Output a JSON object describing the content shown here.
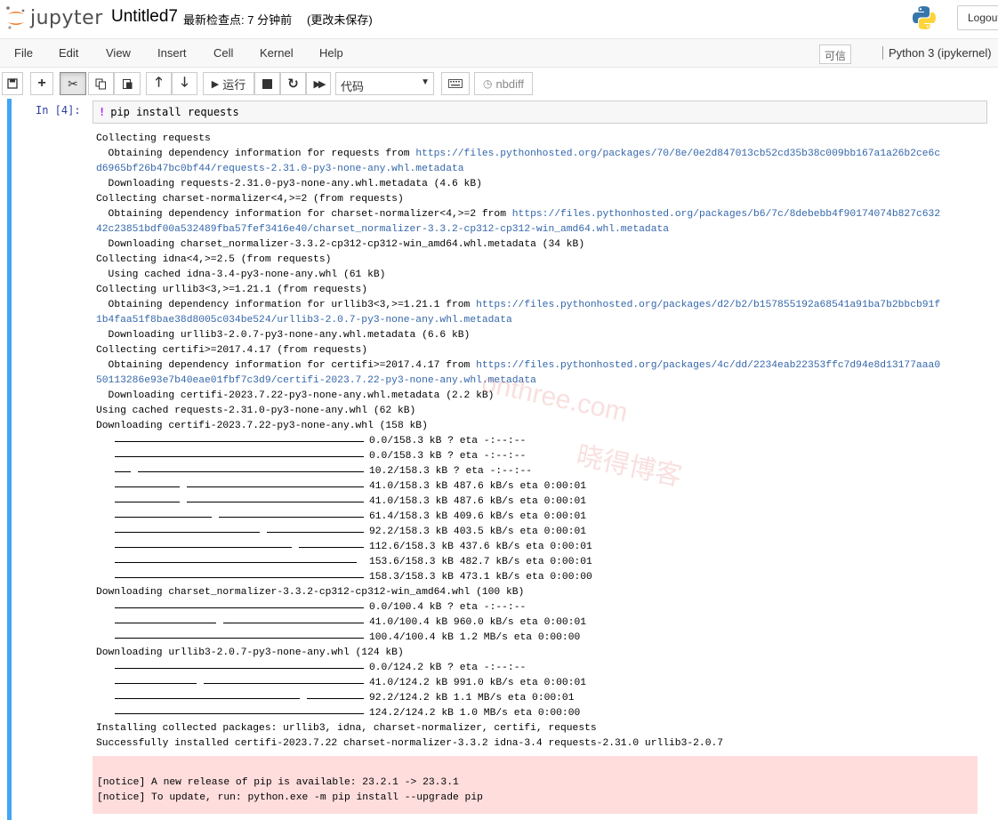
{
  "header": {
    "logo_text": "jupyter",
    "notebook_name": "Untitled7",
    "checkpoint": "最新检查点: 7 分钟前",
    "autosave": "(更改未保存)",
    "logout_label": "Logout"
  },
  "menubar": {
    "items": [
      "File",
      "Edit",
      "View",
      "Insert",
      "Cell",
      "Kernel",
      "Help"
    ],
    "trusted": "可信",
    "kernel": "Python 3 (ipykernel)"
  },
  "toolbar": {
    "run_label": "运行",
    "cell_type": "代码",
    "nbdiff_label": "nbdiff"
  },
  "cell": {
    "prompt": "In  [4]:",
    "code": "pip install requests",
    "output_lines": [
      {
        "text": "Collecting requests"
      },
      {
        "text": "  Obtaining dependency information for requests from ",
        "link": "https://files.pythonhosted.org/packages/70/8e/0e2d847013cb52cd35b38c009bb167a1a26b2ce6c"
      },
      {
        "text": "",
        "link": "d6965bf26b47bc0bf44/requests-2.31.0-py3-none-any.whl.metadata"
      },
      {
        "text": "  Downloading requests-2.31.0-py3-none-any.whl.metadata (4.6 kB)"
      },
      {
        "text": "Collecting charset-normalizer<4,>=2 (from requests)"
      },
      {
        "text": "  Obtaining dependency information for charset-normalizer<4,>=2 from ",
        "link": "https://files.pythonhosted.org/packages/b6/7c/8debebb4f90174074b827c632"
      },
      {
        "text": "",
        "link": "42c23851bdf00a532489fba57fef3416e40/charset_normalizer-3.3.2-cp312-cp312-win_amd64.whl.metadata"
      },
      {
        "text": "  Downloading charset_normalizer-3.3.2-cp312-cp312-win_amd64.whl.metadata (34 kB)"
      },
      {
        "text": "Collecting idna<4,>=2.5 (from requests)"
      },
      {
        "text": "  Using cached idna-3.4-py3-none-any.whl (61 kB)"
      },
      {
        "text": "Collecting urllib3<3,>=1.21.1 (from requests)"
      },
      {
        "text": "  Obtaining dependency information for urllib3<3,>=1.21.1 from ",
        "link": "https://files.pythonhosted.org/packages/d2/b2/b157855192a68541a91ba7b2bbcb91f"
      },
      {
        "text": "",
        "link": "1b4faa51f8bae38d8005c034be524/urllib3-2.0.7-py3-none-any.whl.metadata"
      },
      {
        "text": "  Downloading urllib3-2.0.7-py3-none-any.whl.metadata (6.6 kB)"
      },
      {
        "text": "Collecting certifi>=2017.4.17 (from requests)"
      },
      {
        "text": "  Obtaining dependency information for certifi>=2017.4.17 from ",
        "link": "https://files.pythonhosted.org/packages/4c/dd/2234eab22353ffc7d94e8d13177aaa0"
      },
      {
        "text": "",
        "link": "50113286e93e7b40eae01fbf7c3d9/certifi-2023.7.22-py3-none-any.whl.metadata"
      },
      {
        "text": "  Downloading certifi-2023.7.22-py3-none-any.whl.metadata (2.2 kB)"
      },
      {
        "text": "Using cached requests-2.31.0-py3-none-any.whl (62 kB)"
      },
      {
        "text": "Downloading certifi-2023.7.22-py3-none-any.whl (158 kB)"
      },
      {
        "progress": 0.0,
        "text": "0.0/158.3 kB ? eta -:--:--"
      },
      {
        "progress": 0.0,
        "text": "0.0/158.3 kB ? eta -:--:--"
      },
      {
        "progress": 0.064,
        "text": "10.2/158.3 kB ? eta -:--:--"
      },
      {
        "progress": 0.259,
        "text": "41.0/158.3 kB 487.6 kB/s eta 0:00:01"
      },
      {
        "progress": 0.259,
        "text": "41.0/158.3 kB 487.6 kB/s eta 0:00:01"
      },
      {
        "progress": 0.388,
        "text": "61.4/158.3 kB 409.6 kB/s eta 0:00:01"
      },
      {
        "progress": 0.582,
        "text": "92.2/158.3 kB 403.5 kB/s eta 0:00:01"
      },
      {
        "progress": 0.711,
        "text": "112.6/158.3 kB 437.6 kB/s eta 0:00:01"
      },
      {
        "progress": 0.97,
        "text": "153.6/158.3 kB 482.7 kB/s eta 0:00:01"
      },
      {
        "progress": 1.0,
        "text": "158.3/158.3 kB 473.1 kB/s eta 0:00:00"
      },
      {
        "text": "Downloading charset_normalizer-3.3.2-cp312-cp312-win_amd64.whl (100 kB)"
      },
      {
        "progress": 0.0,
        "text": "0.0/100.4 kB ? eta -:--:--"
      },
      {
        "progress": 0.408,
        "text": "41.0/100.4 kB 960.0 kB/s eta 0:00:01"
      },
      {
        "progress": 1.0,
        "text": "100.4/100.4 kB 1.2 MB/s eta 0:00:00"
      },
      {
        "text": "Downloading urllib3-2.0.7-py3-none-any.whl (124 kB)"
      },
      {
        "progress": 0.0,
        "text": "0.0/124.2 kB ? eta -:--:--"
      },
      {
        "progress": 0.33,
        "text": "41.0/124.2 kB 991.0 kB/s eta 0:00:01"
      },
      {
        "progress": 0.742,
        "text": "92.2/124.2 kB 1.1 MB/s eta 0:00:01"
      },
      {
        "progress": 1.0,
        "text": "124.2/124.2 kB 1.0 MB/s eta 0:00:00"
      },
      {
        "text": "Installing collected packages: urllib3, idna, charset-normalizer, certifi, requests"
      },
      {
        "text": "Successfully installed certifi-2023.7.22 charset-normalizer-3.3.2 idna-3.4 requests-2.31.0 urllib3-2.0.7"
      }
    ],
    "notice_lines": [
      "[notice] A new release of pip is available: 23.2.1 -> 23.3.1",
      "[notice] To update, run: python.exe -m pip install --upgrade pip"
    ]
  },
  "watermark": {
    "line1": "onthree.com",
    "line2": "晓得博客"
  },
  "colors": {
    "cell_border": "#42a5f5",
    "link": "#3366aa",
    "notice_bg": "#ffdddd",
    "prompt": "#303f9f"
  }
}
